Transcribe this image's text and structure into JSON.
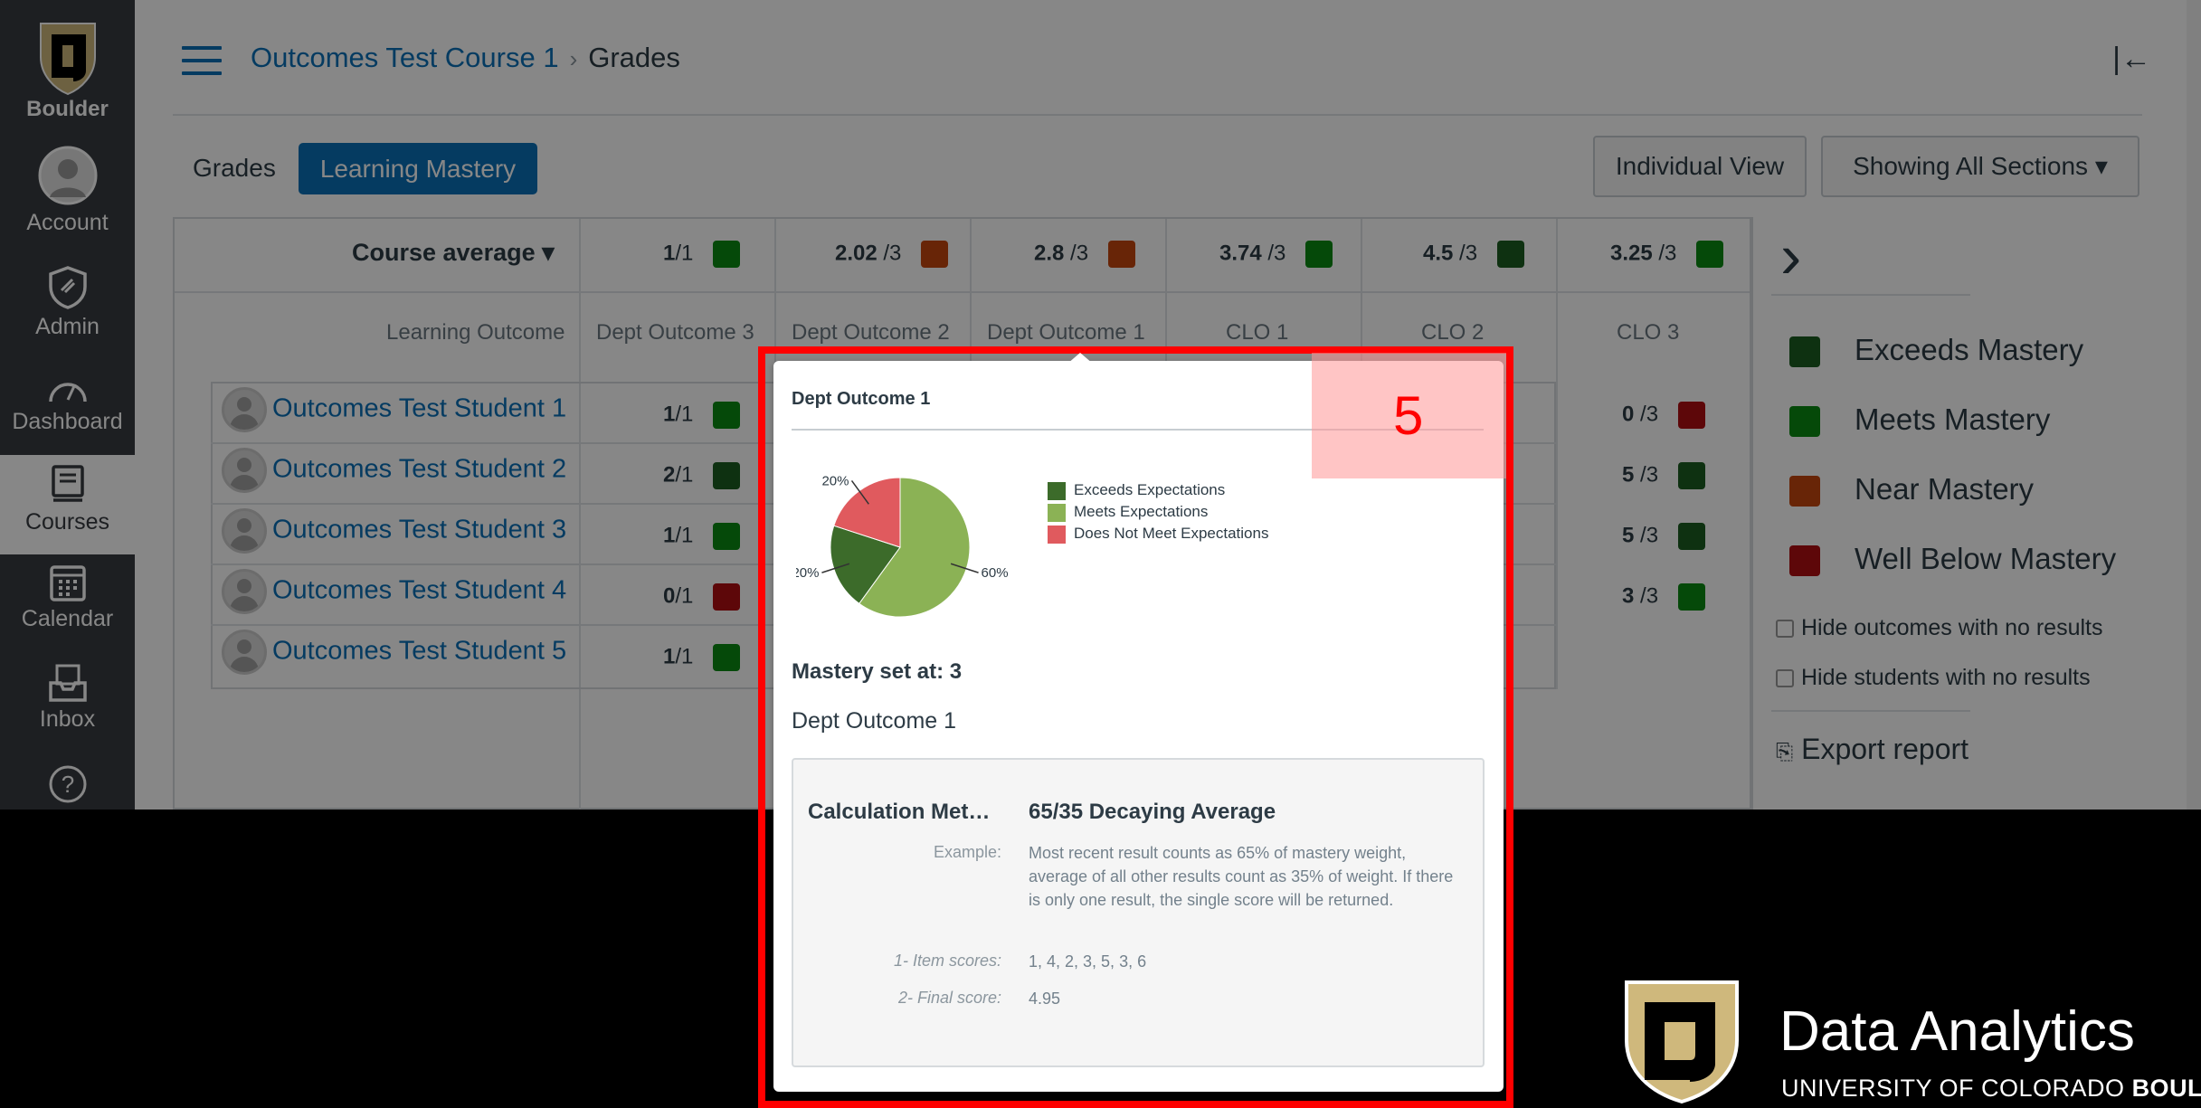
{
  "nav": {
    "logo_label": "Boulder",
    "items": [
      {
        "label": "Account",
        "icon": "account-icon"
      },
      {
        "label": "Admin",
        "icon": "admin-icon"
      },
      {
        "label": "Dashboard",
        "icon": "dashboard-icon"
      },
      {
        "label": "Courses",
        "icon": "courses-icon"
      },
      {
        "label": "Calendar",
        "icon": "calendar-icon"
      },
      {
        "label": "Inbox",
        "icon": "inbox-icon"
      },
      {
        "label": "",
        "icon": "help-icon"
      }
    ]
  },
  "header": {
    "course": "Outcomes Test Course 1",
    "separator": "›",
    "page": "Grades",
    "collapse_icon": "|←"
  },
  "tabs": {
    "grades": "Grades",
    "learning_mastery": "Learning Mastery",
    "individual_view": "Individual View",
    "sections": "Showing All Sections ▾"
  },
  "grid": {
    "course_average_label": "Course average ▾",
    "learning_outcome_label": "Learning Outcome",
    "averages": [
      {
        "score": "1",
        "max": "/1",
        "color": "#0b8a12"
      },
      {
        "score": "2.02",
        "max": "/3",
        "color": "#c4460e"
      },
      {
        "score": "2.8",
        "max": "/3",
        "color": "#c4460e"
      },
      {
        "score": "3.74",
        "max": "/3",
        "color": "#0b8a12"
      },
      {
        "score": "4.5",
        "max": "/3",
        "color": "#1b5e20"
      },
      {
        "score": "3.25",
        "max": "/3",
        "color": "#0b8a12"
      }
    ],
    "outcomes": [
      "Dept Outcome 3",
      "Dept Outcome 2",
      "Dept Outcome 1",
      "CLO 1",
      "CLO 2",
      "CLO 3"
    ],
    "students": [
      {
        "name": "Outcomes Test Student 1",
        "first": "1",
        "first_max": "/1",
        "first_color": "#0b8a12",
        "last": "0",
        "last_max": "/3",
        "last_color": "#b00e12",
        "mid_color": "#1b5e20"
      },
      {
        "name": "Outcomes Test Student 2",
        "first": "2",
        "first_max": "/1",
        "first_color": "#1b5e20",
        "last": "5",
        "last_max": "/3",
        "last_color": "#1b5e20",
        "mid_color": "#1b5e20"
      },
      {
        "name": "Outcomes Test Student 3",
        "first": "1",
        "first_max": "/1",
        "first_color": "#0b8a12",
        "last": "5",
        "last_max": "/3",
        "last_color": "#1b5e20",
        "mid_color": "#1b5e20"
      },
      {
        "name": "Outcomes Test Student 4",
        "first": "0",
        "first_max": "/1",
        "first_color": "#b00e12",
        "last": "3",
        "last_max": "/3",
        "last_color": "#0b8a12",
        "mid_color": "#0b8a12"
      },
      {
        "name": "Outcomes Test Student 5",
        "first": "1",
        "first_max": "/1",
        "first_color": "#0b8a12",
        "last": "",
        "last_max": "",
        "last_color": "",
        "mid_color": ""
      }
    ]
  },
  "side": {
    "chevron": "›",
    "legend": [
      {
        "label": "Exceeds Mastery",
        "color": "#1b5e20"
      },
      {
        "label": "Meets Mastery",
        "color": "#0b8a12"
      },
      {
        "label": "Near Mastery",
        "color": "#c4460e"
      },
      {
        "label": "Well Below Mastery",
        "color": "#b00e12"
      }
    ],
    "hide_outcomes": "Hide outcomes with no results",
    "hide_students": "Hide students with no results",
    "export": "Export report"
  },
  "popover": {
    "title": "Dept Outcome 1",
    "step_number": "5",
    "chart_data": {
      "type": "pie",
      "slices": [
        {
          "label": "Exceeds Expectations",
          "value": 20,
          "color": "#3c6b2a"
        },
        {
          "label": "Meets Expectations",
          "value": 60,
          "color": "#8bb255"
        },
        {
          "label": "Does Not Meet Expectations",
          "value": 20,
          "color": "#e05a5e"
        }
      ],
      "slice_labels": [
        "20%",
        "60%",
        "20%"
      ]
    },
    "mastery": "Mastery set at: 3",
    "outcome_name": "Dept Outcome 1",
    "calc": {
      "method_label": "Calculation Met…",
      "method_value": "65/35 Decaying Average",
      "example_label": "Example:",
      "example_value": "Most recent result counts as 65% of mastery weight, average of all other results count as 35% of weight. If there is only one result, the single score will be returned.",
      "items_label": "1- Item scores:",
      "items_value": "1, 4, 2, 3, 5, 3, 6",
      "final_label": "2- Final score:",
      "final_value": "4.95"
    }
  },
  "brand": {
    "title": "Data Analytics",
    "sub_normal": "UNIVERSITY OF COLORADO ",
    "sub_bold": "BOULD"
  }
}
